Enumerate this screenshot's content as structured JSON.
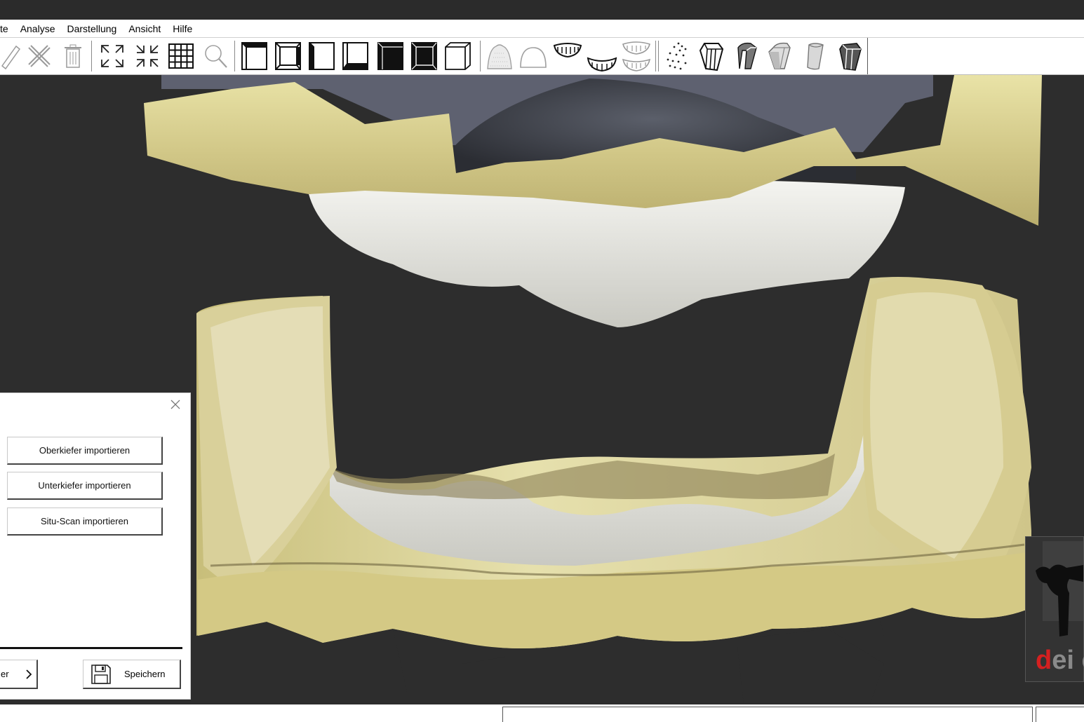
{
  "menu": {
    "items": [
      "te",
      "Analyse",
      "Darstellung",
      "Ansicht",
      "Hilfe"
    ]
  },
  "toolbar": {
    "icons": [
      "ruler-icon",
      "measure-tools-icon",
      "trash-icon",
      "expand-icon",
      "collapse-icon",
      "grid-icon",
      "zoom-icon",
      "view-cube-front-icon",
      "view-cube-top-icon",
      "view-cube-left-icon",
      "view-cube-right-icon",
      "view-cube-back-icon",
      "view-cube-bottom-icon",
      "view-cube-iso-icon",
      "jaw-dotted-icon",
      "jaw-outline-icon",
      "upper-teeth-icon",
      "lower-teeth-icon",
      "both-teeth-icon",
      "pointcloud-icon",
      "die-icon",
      "die-2-icon",
      "die-3-icon",
      "die-4-icon",
      "die-5-icon"
    ]
  },
  "panel": {
    "close_label": "×",
    "buttons": [
      "Oberkiefer importieren",
      "Unterkiefer importieren",
      "Situ-Scan importieren"
    ],
    "next_label": "er",
    "next_arrow": "›",
    "save_label": "Speichern"
  },
  "logo": {
    "text_red": "d",
    "text_rest": "ei e"
  },
  "colors": {
    "background": "#2d2d2d",
    "gingiva_yellow": "#d9cf8e",
    "model_white": "#dcdcd6",
    "logo_red": "#d42020"
  }
}
